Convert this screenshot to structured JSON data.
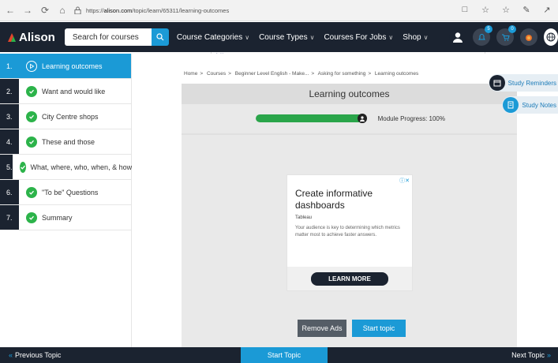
{
  "browser": {
    "url_prefix": "https://",
    "url_host": "alison.com",
    "url_path": "/topic/learn/65311/learning-outcomes"
  },
  "header": {
    "logo_text": "Alison",
    "search_placeholder": "Search for courses",
    "menu": [
      {
        "label": "Course Categories"
      },
      {
        "label": "Course Types"
      },
      {
        "label": "Courses For Jobs"
      },
      {
        "label": "Shop"
      }
    ],
    "notification_count": "5",
    "cart_count": "0"
  },
  "sidebar": {
    "items": [
      {
        "num": "1.",
        "label": "Learning outcomes",
        "active": true
      },
      {
        "num": "2.",
        "label": "Want and would like"
      },
      {
        "num": "3.",
        "label": "City Centre shops"
      },
      {
        "num": "4.",
        "label": "These and those"
      },
      {
        "num": "5.",
        "label": "What, where, who, when, & how"
      },
      {
        "num": "6.",
        "label": "\"To be\" Questions"
      },
      {
        "num": "7.",
        "label": "Summary"
      }
    ]
  },
  "breadcrumb": [
    "Home",
    "Courses",
    "Beginner Level English - Make...",
    "Asking for something",
    "Learning outcomes"
  ],
  "module": {
    "title": "Learning outcomes",
    "progress_label": "Module Progress: 100%",
    "progress_value": 100
  },
  "ad": {
    "headline": "Create informative dashboards",
    "brand": "Tableau",
    "body": "Your audience is key to determining which metrics matter most to achieve faster answers.",
    "cta": "LEARN MORE"
  },
  "actions": {
    "remove_ads": "Remove Ads",
    "start_topic": "Start topic"
  },
  "tools": {
    "reminder": "Study Reminders",
    "notes": "Study Notes"
  },
  "footer": {
    "prev": "Previous Topic",
    "center": "Start Topic",
    "next": "Next Topic"
  },
  "colors": {
    "brand_dark": "#1b2330",
    "accent_blue": "#1b9ad6",
    "success_green": "#2cb34a"
  }
}
